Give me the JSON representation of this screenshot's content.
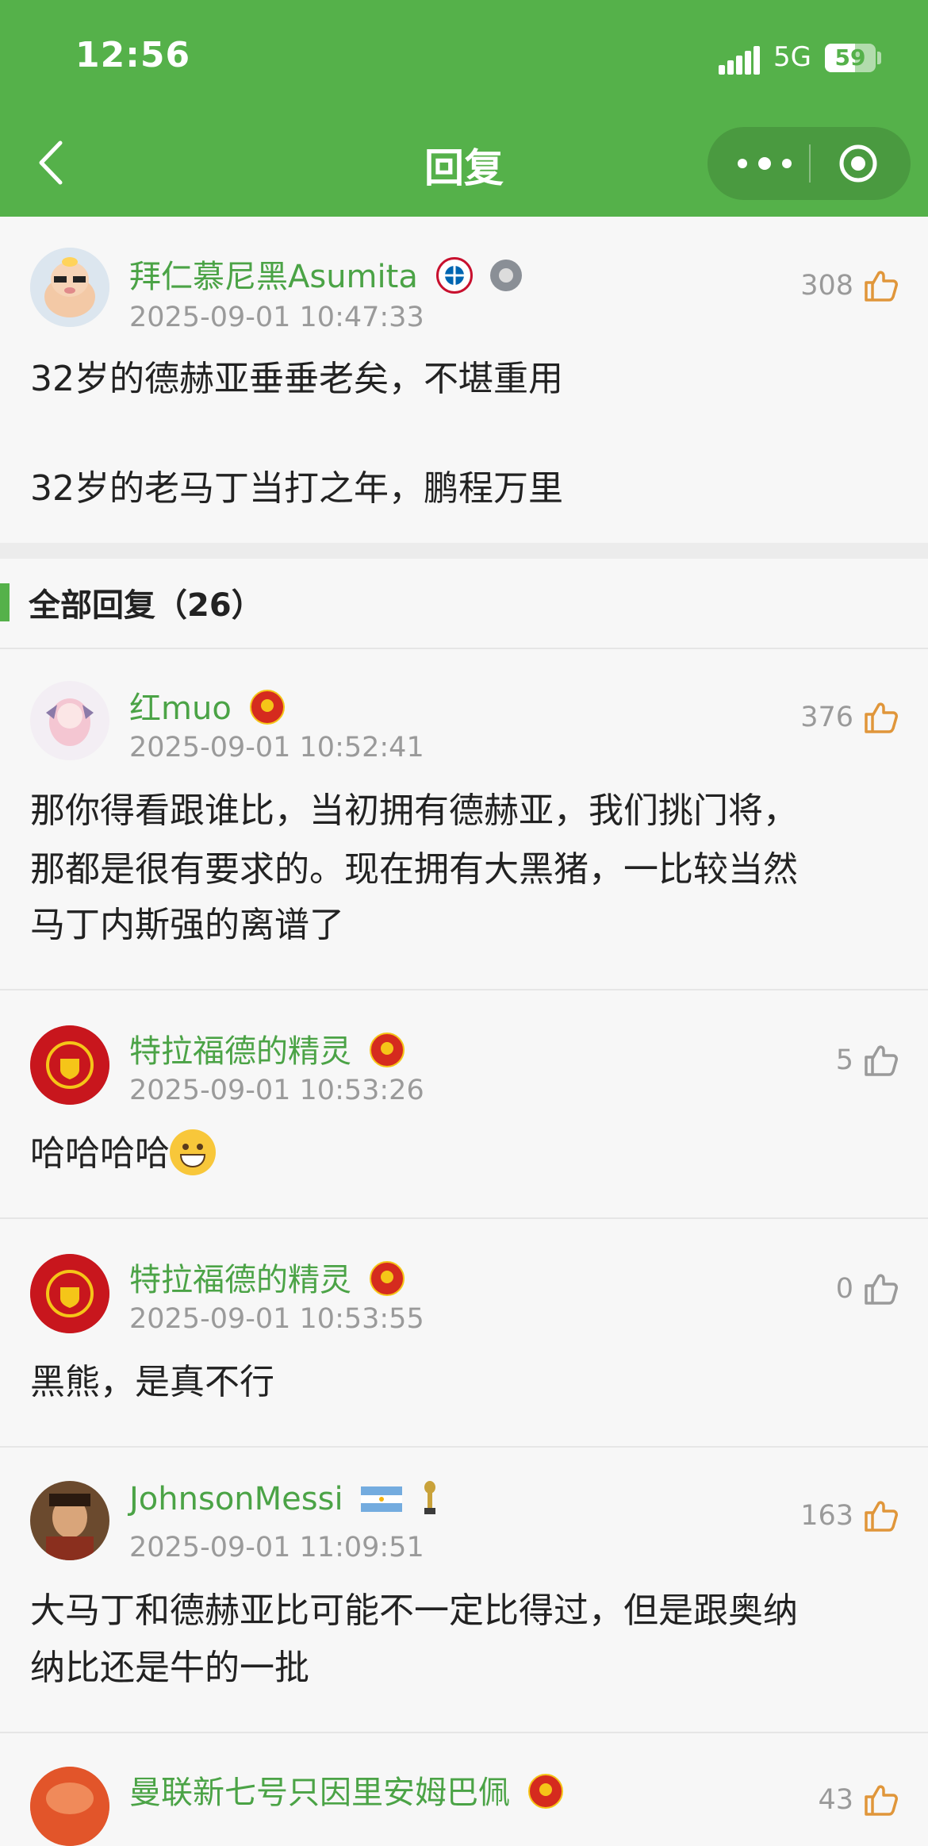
{
  "status": {
    "time": "12:56",
    "network": "5G",
    "battery": "59",
    "battery_level": 0.59
  },
  "nav": {
    "title": "回复"
  },
  "main_post": {
    "username": "拜仁慕尼黑Asumita",
    "timestamp": "2025-09-01 10:47:33",
    "likes": "308",
    "line1": "32岁的德赫亚垂垂老矣，不堪重用",
    "line2": "32岁的老马丁当打之年，鹏程万里"
  },
  "section": {
    "title": "全部回复（26）"
  },
  "replies": [
    {
      "username": "红muo",
      "timestamp": "2025-09-01 10:52:41",
      "likes": "376",
      "lines": [
        "那你得看跟谁比，当初拥有德赫亚，我们挑门将，",
        "那都是很有要求的。现在拥有大黑猪，一比较当然",
        "马丁内斯强的离谱了"
      ]
    },
    {
      "username": "特拉福德的精灵",
      "timestamp": "2025-09-01 10:53:26",
      "likes": "5",
      "text": "哈哈哈哈"
    },
    {
      "username": "特拉福德的精灵",
      "timestamp": "2025-09-01 10:53:55",
      "likes": "0",
      "text": "黑熊，是真不行"
    },
    {
      "username": "JohnsonMessi",
      "timestamp": "2025-09-01 11:09:51",
      "likes": "163",
      "lines": [
        "大马丁和德赫亚比可能不一定比得过，但是跟奥纳",
        "纳比还是牛的一批"
      ]
    },
    {
      "username": "曼联新七号只因里安姆巴佩",
      "likes": "43"
    }
  ],
  "icons": {
    "back": "chevron-left-icon",
    "more": "more-dots-icon",
    "close": "target-circle-icon",
    "like": "thumbs-up-icon",
    "team_badge": "manchester-united-badge-icon",
    "bayern_badge": "bayern-munich-badge-icon",
    "argentina_flag": "argentina-flag-icon",
    "trophy": "trophy-icon",
    "emoji": "grinning-face-emoji"
  },
  "colors": {
    "primary": "#55b14a",
    "username": "#4ba346",
    "liked": "#e0963a",
    "unliked": "#9a9a9a"
  }
}
